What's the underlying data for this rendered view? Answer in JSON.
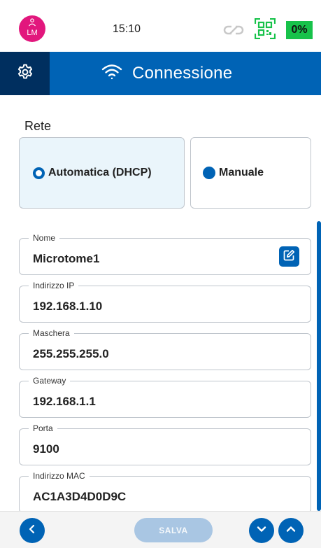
{
  "status_bar": {
    "avatar_initials": "LM",
    "time": "15:10",
    "battery_level": "0%",
    "icons": [
      "user-icon",
      "link-icon",
      "qr-code-icon"
    ],
    "colors": {
      "avatar": "#e2177d",
      "battery": "#17c24a"
    }
  },
  "header": {
    "title": "Connessione",
    "icons": [
      "gear-icon",
      "wifi-icon"
    ],
    "colors": {
      "bar": "#0063b5",
      "settings_bg": "#002f5f"
    }
  },
  "network": {
    "section_label": "Rete",
    "options": [
      {
        "label": "Automatica (DHCP)",
        "selected": true
      },
      {
        "label": "Manuale",
        "selected": false
      }
    ]
  },
  "fields": [
    {
      "label": "Nome",
      "value": "Microtome1"
    },
    {
      "label": "Indirizzo IP",
      "value": "192.168.1.10"
    },
    {
      "label": "Maschera",
      "value": "255.255.255.0"
    },
    {
      "label": "Gateway",
      "value": "192.168.1.1"
    },
    {
      "label": "Porta",
      "value": "9100"
    },
    {
      "label": "Indirizzo MAC",
      "value": "AC1A3D4D0D9C"
    }
  ],
  "bottom_bar": {
    "save_label": "SALVA",
    "icons": [
      "chevron-left-icon",
      "chevron-down-icon",
      "chevron-up-icon"
    ]
  }
}
